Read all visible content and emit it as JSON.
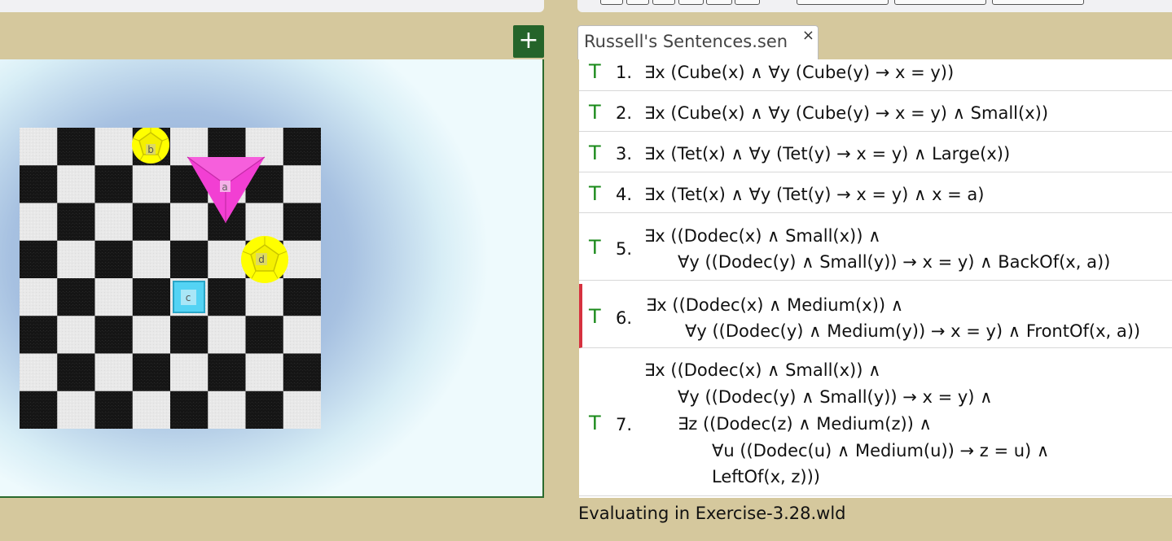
{
  "toolbar": {
    "add_label": "+"
  },
  "world": {
    "objects": [
      {
        "label": "a",
        "shape": "tetrahedron",
        "size": "large",
        "color": "#f23fd3"
      },
      {
        "label": "b",
        "shape": "dodecahedron",
        "size": "small",
        "color": "#ffff00"
      },
      {
        "label": "c",
        "shape": "cube",
        "size": "small",
        "color": "#54d3f4"
      },
      {
        "label": "d",
        "shape": "dodecahedron",
        "size": "medium",
        "color": "#ffff00"
      }
    ]
  },
  "tab": {
    "title": "Russell's Sentences.sen",
    "close": "×"
  },
  "sentences": [
    {
      "value": "T",
      "num": "1.",
      "lines": [
        "∃x (Cube(x) ∧ ∀y (Cube(y) → x = y))"
      ]
    },
    {
      "value": "T",
      "num": "2.",
      "lines": [
        "∃x (Cube(x) ∧ ∀y (Cube(y) → x = y) ∧ Small(x))"
      ]
    },
    {
      "value": "T",
      "num": "3.",
      "lines": [
        "∃x (Tet(x) ∧ ∀y (Tet(y) → x = y) ∧ Large(x))"
      ]
    },
    {
      "value": "T",
      "num": "4.",
      "lines": [
        "∃x (Tet(x) ∧ ∀y (Tet(y) → x = y) ∧ x = a)"
      ]
    },
    {
      "value": "T",
      "num": "5.",
      "lines": [
        "∃x ((Dodec(x) ∧ Small(x)) ∧",
        "∀y ((Dodec(y) ∧ Small(y)) → x = y) ∧ BackOf(x, a))"
      ]
    },
    {
      "value": "T",
      "num": "6.",
      "lines": [
        "∃x ((Dodec(x) ∧ Medium(x)) ∧",
        "∀y ((Dodec(y) ∧ Medium(y)) → x = y) ∧ FrontOf(x, a))"
      ]
    },
    {
      "value": "T",
      "num": "7.",
      "lines": [
        "∃x ((Dodec(x) ∧ Small(x)) ∧",
        "∀y ((Dodec(y) ∧ Small(y)) → x = y) ∧",
        "∃z ((Dodec(z) ∧ Medium(z)) ∧",
        "∀u ((Dodec(u) ∧ Medium(u)) → z = u) ∧",
        "LeftOf(x, z)))"
      ]
    }
  ],
  "status": "Evaluating in Exercise-3.28.wld"
}
